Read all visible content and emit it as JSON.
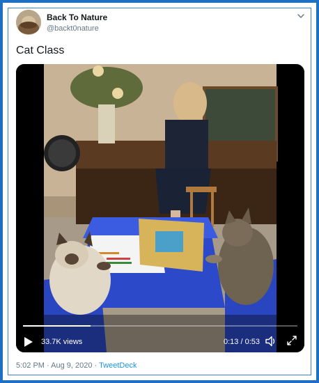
{
  "tweet": {
    "author": {
      "name": "Back To Nature",
      "handle": "@backt0nature"
    },
    "text": "Cat Class",
    "video": {
      "views": "33.7K views",
      "time": "0:13 / 0:53",
      "progress": 0.245
    },
    "meta": {
      "time": "5:02 PM",
      "separator1": " · ",
      "date": "Aug 9, 2020",
      "separator2": " · ",
      "source": "TweetDeck"
    }
  },
  "icons": {
    "menu": "chevron-down-icon",
    "play": "play-icon",
    "volume": "volume-icon",
    "fullscreen": "fullscreen-icon"
  },
  "colors": {
    "frame": "#1f6fc5",
    "link": "#1b95e0",
    "secondary_text": "#657786",
    "primary_text": "#14171a"
  }
}
